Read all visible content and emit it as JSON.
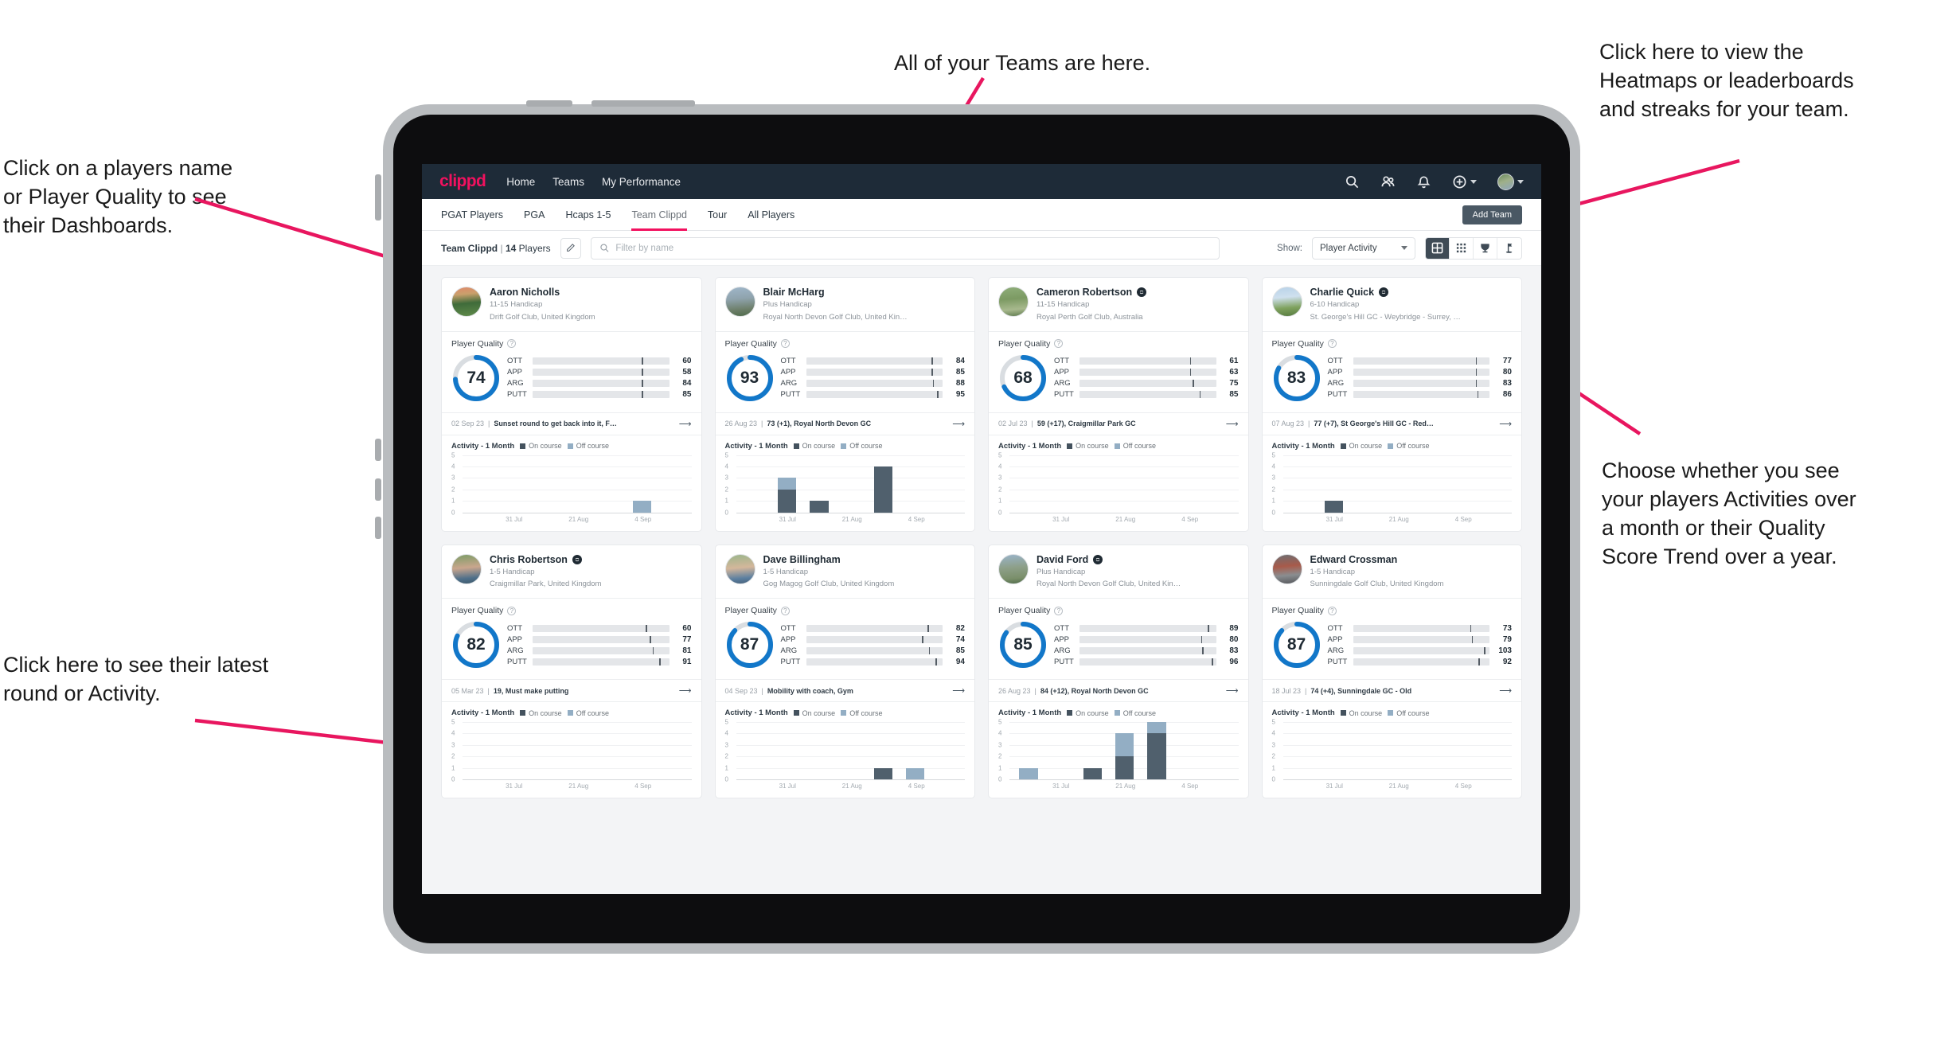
{
  "annotations": [
    {
      "id": "teams",
      "text": "All of your Teams are here."
    },
    {
      "id": "heatmaps",
      "text": "Click here to view the\nHeatmaps or leaderboards\nand streaks for your team."
    },
    {
      "id": "players",
      "text": "Click on a players name\nor Player Quality to see\ntheir Dashboards."
    },
    {
      "id": "show",
      "text": "Choose whether you see\nyour players Activities over\na month or their Quality\nScore Trend over a year."
    },
    {
      "id": "latest",
      "text": "Click here to see their latest\nround or Activity."
    }
  ],
  "topnav": {
    "logo": "clippd",
    "links": [
      "Home",
      "Teams",
      "My Performance"
    ],
    "icons": [
      "search-icon",
      "people-icon",
      "bell-icon",
      "plus-circle-icon",
      "avatar"
    ]
  },
  "subnav": {
    "tabs": [
      {
        "label": "PGAT Players",
        "active": false
      },
      {
        "label": "PGA",
        "active": false
      },
      {
        "label": "Hcaps 1-5",
        "active": false
      },
      {
        "label": "Team Clippd",
        "active": true
      },
      {
        "label": "Tour",
        "active": false
      },
      {
        "label": "All Players",
        "active": false
      }
    ],
    "add_team_label": "Add Team"
  },
  "toolbar": {
    "team_name": "Team Clippd",
    "separator": "|",
    "player_count": "14",
    "players_word": "Players",
    "edit_icon": "pencil-icon",
    "search_placeholder": "Filter by name",
    "search_value": "",
    "show_label": "Show:",
    "show_value": "Player Activity",
    "show_options": [
      "Player Activity",
      "Quality Score Trend"
    ],
    "views": [
      {
        "name": "grid-view",
        "active": true
      },
      {
        "name": "dense-grid-view",
        "active": false
      },
      {
        "name": "trophy-view",
        "active": false
      },
      {
        "name": "golf-flag-view",
        "active": false
      }
    ]
  },
  "quality_colors": {
    "OTT": "#f5a623",
    "APP": "#34d8a8",
    "ARG": "#f2115f",
    "PUTT": "#a216c9",
    "ring": "#1277c9",
    "ring_track": "#d9dde1"
  },
  "chart_data": {
    "type": "bar",
    "title": "Activity - 1 Month",
    "legend": [
      "On course",
      "Off course"
    ],
    "legend_position": "top-right",
    "xlabel": "",
    "ylabel": "",
    "ylim": [
      0,
      5
    ],
    "yticks": [
      0,
      1,
      2,
      3,
      4,
      5
    ],
    "xticks": [
      "31 Jul",
      "21 Aug",
      "4 Sep"
    ],
    "grid": true,
    "colors": {
      "On course": "#50606d",
      "Off course": "#93aec4"
    },
    "charts": [
      {
        "player": "Aaron Nicholls",
        "series": [
          {
            "name": "On course",
            "values": [
              0,
              0,
              0,
              0,
              0,
              0,
              0
            ]
          },
          {
            "name": "Off course",
            "values": [
              0,
              0,
              0,
              0,
              0,
              1,
              0
            ]
          }
        ]
      },
      {
        "player": "Blair McHarg",
        "series": [
          {
            "name": "On course",
            "values": [
              0,
              2,
              1,
              0,
              4,
              0,
              0
            ]
          },
          {
            "name": "Off course",
            "values": [
              0,
              1,
              0,
              0,
              0,
              0,
              0
            ]
          }
        ]
      },
      {
        "player": "Cameron Robertson",
        "series": [
          {
            "name": "On course",
            "values": [
              0,
              0,
              0,
              0,
              0,
              0,
              0
            ]
          },
          {
            "name": "Off course",
            "values": [
              0,
              0,
              0,
              0,
              0,
              0,
              0
            ]
          }
        ]
      },
      {
        "player": "Charlie Quick",
        "series": [
          {
            "name": "On course",
            "values": [
              0,
              1,
              0,
              0,
              0,
              0,
              0
            ]
          },
          {
            "name": "Off course",
            "values": [
              0,
              0,
              0,
              0,
              0,
              0,
              0
            ]
          }
        ]
      },
      {
        "player": "Chris Robertson",
        "series": [
          {
            "name": "On course",
            "values": [
              0,
              0,
              0,
              0,
              0,
              0,
              0
            ]
          },
          {
            "name": "Off course",
            "values": [
              0,
              0,
              0,
              0,
              0,
              0,
              0
            ]
          }
        ]
      },
      {
        "player": "Dave Billingham",
        "series": [
          {
            "name": "On course",
            "values": [
              0,
              0,
              0,
              0,
              1,
              0,
              0
            ]
          },
          {
            "name": "Off course",
            "values": [
              0,
              0,
              0,
              0,
              0,
              1,
              0
            ]
          }
        ]
      },
      {
        "player": "David Ford",
        "series": [
          {
            "name": "On course",
            "values": [
              0,
              0,
              1,
              2,
              4,
              0,
              0
            ]
          },
          {
            "name": "Off course",
            "values": [
              1,
              0,
              0,
              2,
              1,
              0,
              0
            ]
          }
        ]
      },
      {
        "player": "Edward Crossman",
        "series": [
          {
            "name": "On course",
            "values": [
              0,
              0,
              0,
              0,
              0,
              0,
              0
            ]
          },
          {
            "name": "Off course",
            "values": [
              0,
              0,
              0,
              0,
              0,
              0,
              0
            ]
          }
        ]
      }
    ]
  },
  "players": [
    {
      "name": "Aaron Nicholls",
      "verified": false,
      "avatar": "pa1",
      "handicap": "11-15 Handicap",
      "club": "Drift Golf Club, United Kingdom",
      "quality_title": "Player Quality",
      "score": 74,
      "metrics": [
        {
          "label": "OTT",
          "value": 60,
          "fill": 62,
          "tick": 80
        },
        {
          "label": "APP",
          "value": 58,
          "fill": 60,
          "tick": 80
        },
        {
          "label": "ARG",
          "value": 84,
          "fill": 84,
          "tick": 80
        },
        {
          "label": "PUTT",
          "value": 85,
          "fill": 85,
          "tick": 80
        }
      ],
      "latest_date": "02 Sep 23",
      "latest_text": "Sunset round to get back into it, F…",
      "activity_title": "Activity - 1 Month"
    },
    {
      "name": "Blair McHarg",
      "verified": false,
      "avatar": "pa2",
      "handicap": "Plus Handicap",
      "club": "Royal North Devon Golf Club, United Kin…",
      "quality_title": "Player Quality",
      "score": 93,
      "metrics": [
        {
          "label": "OTT",
          "value": 84,
          "fill": 88,
          "tick": 92
        },
        {
          "label": "APP",
          "value": 85,
          "fill": 90,
          "tick": 92
        },
        {
          "label": "ARG",
          "value": 88,
          "fill": 90,
          "tick": 93
        },
        {
          "label": "PUTT",
          "value": 95,
          "fill": 95,
          "tick": 96
        }
      ],
      "latest_date": "26 Aug 23",
      "latest_text": "73 (+1), Royal North Devon GC",
      "activity_title": "Activity - 1 Month"
    },
    {
      "name": "Cameron Robertson",
      "verified": true,
      "avatar": "pa3",
      "handicap": "11-15 Handicap",
      "club": "Royal Perth Golf Club, Australia",
      "quality_title": "Player Quality",
      "score": 68,
      "metrics": [
        {
          "label": "OTT",
          "value": 61,
          "fill": 63,
          "tick": 81
        },
        {
          "label": "APP",
          "value": 63,
          "fill": 65,
          "tick": 81
        },
        {
          "label": "ARG",
          "value": 75,
          "fill": 77,
          "tick": 83
        },
        {
          "label": "PUTT",
          "value": 85,
          "fill": 85,
          "tick": 88
        }
      ],
      "latest_date": "02 Jul 23",
      "latest_text": "59 (+17), Craigmillar Park GC",
      "activity_title": "Activity - 1 Month"
    },
    {
      "name": "Charlie Quick",
      "verified": true,
      "avatar": "pa4",
      "handicap": "6-10 Handicap",
      "club": "St. George's Hill GC - Weybridge - Surrey, …",
      "quality_title": "Player Quality",
      "score": 83,
      "metrics": [
        {
          "label": "OTT",
          "value": 77,
          "fill": 79,
          "tick": 90
        },
        {
          "label": "APP",
          "value": 80,
          "fill": 82,
          "tick": 90
        },
        {
          "label": "ARG",
          "value": 83,
          "fill": 84,
          "tick": 90
        },
        {
          "label": "PUTT",
          "value": 86,
          "fill": 86,
          "tick": 91
        }
      ],
      "latest_date": "07 Aug 23",
      "latest_text": "77 (+7), St George's Hill GC - Red…",
      "activity_title": "Activity - 1 Month"
    },
    {
      "name": "Chris Robertson",
      "verified": true,
      "avatar": "pa5",
      "handicap": "1-5 Handicap",
      "club": "Craigmillar Park, United Kingdom",
      "quality_title": "Player Quality",
      "score": 82,
      "metrics": [
        {
          "label": "OTT",
          "value": 60,
          "fill": 62,
          "tick": 83
        },
        {
          "label": "APP",
          "value": 77,
          "fill": 78,
          "tick": 86
        },
        {
          "label": "ARG",
          "value": 81,
          "fill": 82,
          "tick": 88
        },
        {
          "label": "PUTT",
          "value": 91,
          "fill": 91,
          "tick": 93
        }
      ],
      "latest_date": "05 Mar 23",
      "latest_text": "19, Must make putting",
      "activity_title": "Activity - 1 Month"
    },
    {
      "name": "Dave Billingham",
      "verified": false,
      "avatar": "pa6",
      "handicap": "1-5 Handicap",
      "club": "Gog Magog Golf Club, United Kingdom",
      "quality_title": "Player Quality",
      "score": 87,
      "metrics": [
        {
          "label": "OTT",
          "value": 82,
          "fill": 84,
          "tick": 89
        },
        {
          "label": "APP",
          "value": 74,
          "fill": 76,
          "tick": 85
        },
        {
          "label": "ARG",
          "value": 85,
          "fill": 86,
          "tick": 90
        },
        {
          "label": "PUTT",
          "value": 94,
          "fill": 93,
          "tick": 95
        }
      ],
      "latest_date": "04 Sep 23",
      "latest_text": "Mobility with coach, Gym",
      "activity_title": "Activity - 1 Month"
    },
    {
      "name": "David Ford",
      "verified": true,
      "avatar": "pa7",
      "handicap": "Plus Handicap",
      "club": "Royal North Devon Golf Club, United Kin…",
      "quality_title": "Player Quality",
      "score": 85,
      "metrics": [
        {
          "label": "OTT",
          "value": 89,
          "fill": 90,
          "tick": 94
        },
        {
          "label": "APP",
          "value": 80,
          "fill": 82,
          "tick": 89
        },
        {
          "label": "ARG",
          "value": 83,
          "fill": 84,
          "tick": 90
        },
        {
          "label": "PUTT",
          "value": 96,
          "fill": 94,
          "tick": 97
        }
      ],
      "latest_date": "26 Aug 23",
      "latest_text": "84 (+12), Royal North Devon GC",
      "activity_title": "Activity - 1 Month"
    },
    {
      "name": "Edward Crossman",
      "verified": false,
      "avatar": "pa8",
      "handicap": "1-5 Handicap",
      "club": "Sunningdale Golf Club, United Kingdom",
      "quality_title": "Player Quality",
      "score": 87,
      "metrics": [
        {
          "label": "OTT",
          "value": 73,
          "fill": 73,
          "tick": 86
        },
        {
          "label": "APP",
          "value": 79,
          "fill": 78,
          "tick": 87
        },
        {
          "label": "ARG",
          "value": 103,
          "fill": 92,
          "tick": 96
        },
        {
          "label": "PUTT",
          "value": 92,
          "fill": 88,
          "tick": 92
        }
      ],
      "latest_date": "18 Jul 23",
      "latest_text": "74 (+4), Sunningdale GC - Old",
      "activity_title": "Activity - 1 Month"
    }
  ]
}
